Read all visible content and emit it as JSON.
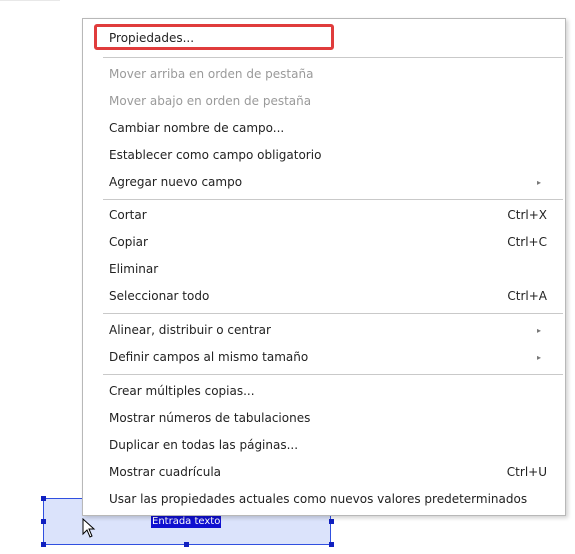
{
  "context_menu": {
    "items": [
      {
        "label": "Propiedades...",
        "shortcut": "",
        "submenu": false,
        "disabled": false
      },
      {
        "label": "Mover arriba en orden de pestaña",
        "shortcut": "",
        "submenu": false,
        "disabled": true
      },
      {
        "label": "Mover abajo en orden de pestaña",
        "shortcut": "",
        "submenu": false,
        "disabled": true
      },
      {
        "label": "Cambiar nombre de campo...",
        "shortcut": "",
        "submenu": false,
        "disabled": false
      },
      {
        "label": "Establecer como campo obligatorio",
        "shortcut": "",
        "submenu": false,
        "disabled": false
      },
      {
        "label": "Agregar nuevo campo",
        "shortcut": "",
        "submenu": true,
        "disabled": false
      },
      {
        "label": "Cortar",
        "shortcut": "Ctrl+X",
        "submenu": false,
        "disabled": false
      },
      {
        "label": "Copiar",
        "shortcut": "Ctrl+C",
        "submenu": false,
        "disabled": false
      },
      {
        "label": "Eliminar",
        "shortcut": "",
        "submenu": false,
        "disabled": false
      },
      {
        "label": "Seleccionar todo",
        "shortcut": "Ctrl+A",
        "submenu": false,
        "disabled": false
      },
      {
        "label": "Alinear, distribuir o centrar",
        "shortcut": "",
        "submenu": true,
        "disabled": false
      },
      {
        "label": "Definir campos al mismo tamaño",
        "shortcut": "",
        "submenu": true,
        "disabled": false
      },
      {
        "label": "Crear múltiples copias...",
        "shortcut": "",
        "submenu": false,
        "disabled": false
      },
      {
        "label": "Mostrar números de tabulaciones",
        "shortcut": "",
        "submenu": false,
        "disabled": false
      },
      {
        "label": "Duplicar en todas las páginas...",
        "shortcut": "",
        "submenu": false,
        "disabled": false
      },
      {
        "label": "Mostrar cuadrícula",
        "shortcut": "Ctrl+U",
        "submenu": false,
        "disabled": false
      },
      {
        "label": "Usar las propiedades actuales como nuevos valores predeterminados",
        "shortcut": "",
        "submenu": false,
        "disabled": false
      }
    ],
    "submenu_arrow": "▸",
    "highlight_color": "#e03c3c"
  },
  "form_field": {
    "label": "Entrada texto",
    "selection_color": "#3050e0",
    "fill_color": "#dbe3fb"
  },
  "cursor_icon": "arrow-pointer-icon"
}
